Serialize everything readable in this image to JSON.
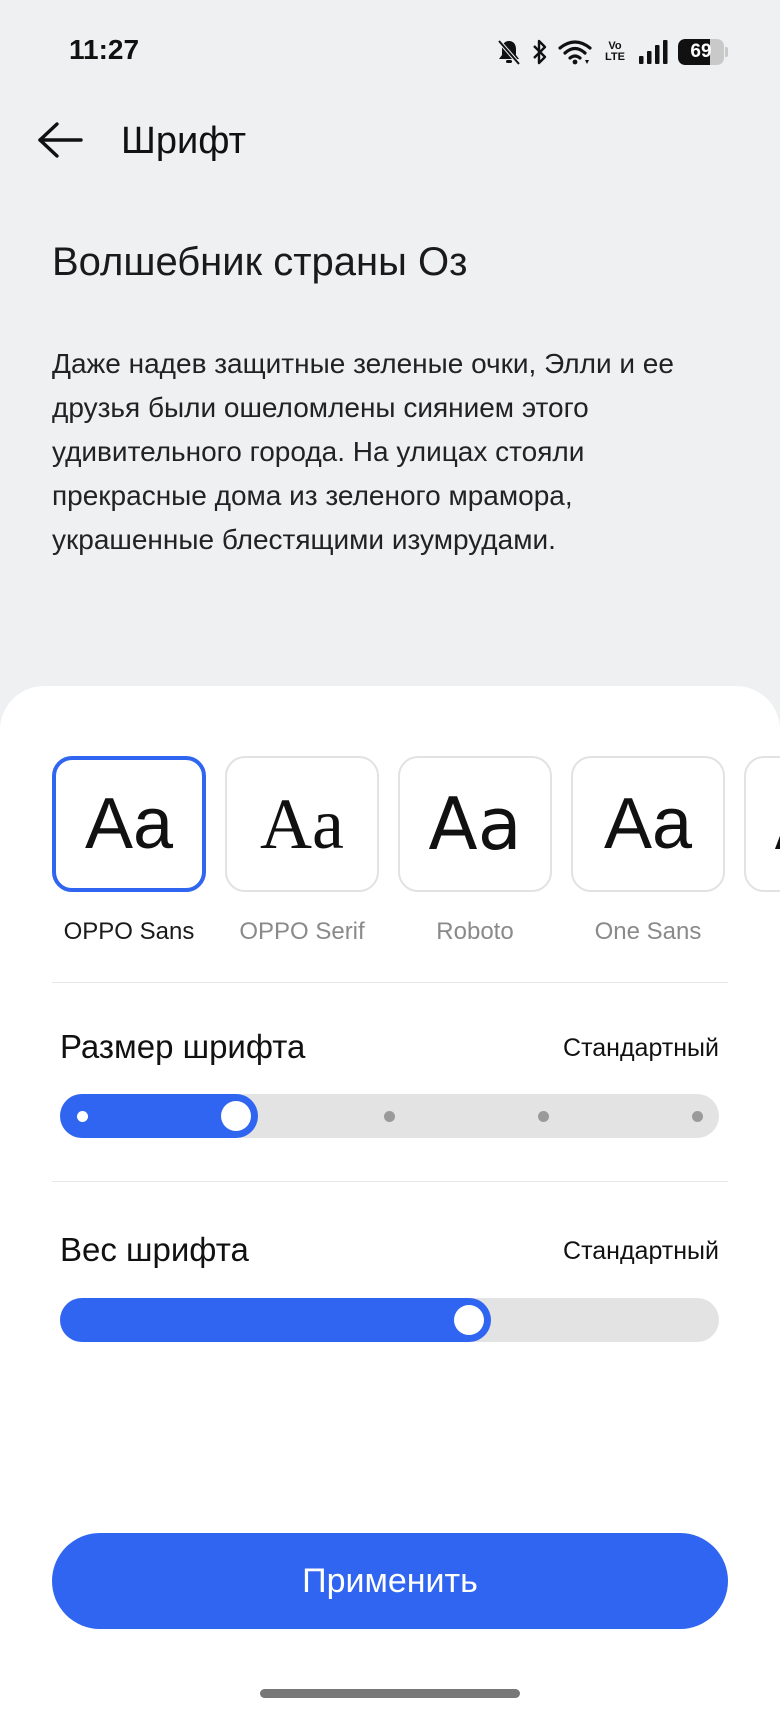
{
  "status_bar": {
    "time": "11:27",
    "network_label": "Vo\nLTE",
    "battery_percent": "69",
    "battery_level": 0.69,
    "icons": [
      "mute-bell-icon",
      "bluetooth-icon",
      "wifi-icon",
      "volte-icon",
      "signal-icon",
      "battery-icon"
    ]
  },
  "header": {
    "back_icon": "arrow-left-icon",
    "title": "Шрифт"
  },
  "preview": {
    "title": "Волшебник страны Оз",
    "text": "Даже надев защитные зеленые очки, Элли и ее друзья были ошеломлены сиянием этого удивительного города. На улицах стояли прекрасные дома из зеленого мрамора, украшенные блестящими изумрудами."
  },
  "fonts": {
    "sample": "Aa",
    "items": [
      {
        "name": "OPPO Sans",
        "selected": true
      },
      {
        "name": "OPPO Serif",
        "selected": false
      },
      {
        "name": "Roboto",
        "selected": false
      },
      {
        "name": "One Sans",
        "selected": false
      },
      {
        "name": "",
        "selected": false
      }
    ]
  },
  "font_size": {
    "label": "Размер шрифта",
    "value": "Стандартный",
    "steps": 5,
    "selected_step": 2
  },
  "font_weight": {
    "label": "Вес шрифта",
    "value": "Стандартный",
    "level": 0.63
  },
  "apply_button": "Применить",
  "colors": {
    "accent": "#2f65f0",
    "background": "#eff0f2",
    "sheet": "#ffffff"
  }
}
